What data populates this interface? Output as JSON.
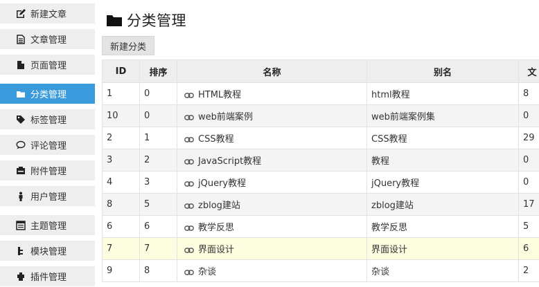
{
  "sidebar": {
    "items": [
      {
        "label": "新建文章",
        "icon": "edit-icon"
      },
      {
        "label": "文章管理",
        "icon": "document-icon"
      },
      {
        "label": "页面管理",
        "icon": "page-icon"
      },
      {
        "label": "分类管理",
        "icon": "folder-icon",
        "active": true
      },
      {
        "label": "标签管理",
        "icon": "tag-icon"
      },
      {
        "label": "评论管理",
        "icon": "comment-icon"
      },
      {
        "label": "附件管理",
        "icon": "attachment-icon"
      },
      {
        "label": "用户管理",
        "icon": "user-icon"
      },
      {
        "label": "主题管理",
        "icon": "theme-icon"
      },
      {
        "label": "模块管理",
        "icon": "module-icon"
      },
      {
        "label": "插件管理",
        "icon": "plugin-icon"
      }
    ]
  },
  "header": {
    "title": "分类管理",
    "icon": "folder-icon"
  },
  "toolbar": {
    "new_category_label": "新建分类"
  },
  "table": {
    "columns": [
      "ID",
      "排序",
      "名称",
      "别名",
      "文"
    ],
    "rows": [
      {
        "id": "1",
        "order": "0",
        "name": "HTML教程",
        "alias": "html教程",
        "count": "8"
      },
      {
        "id": "10",
        "order": "0",
        "name": "web前端案例",
        "alias": "web前端案例集",
        "count": "0"
      },
      {
        "id": "2",
        "order": "1",
        "name": "CSS教程",
        "alias": "CSS教程",
        "count": "29"
      },
      {
        "id": "3",
        "order": "2",
        "name": "JavaScript教程",
        "alias": "教程",
        "count": "0"
      },
      {
        "id": "4",
        "order": "3",
        "name": "jQuery教程",
        "alias": "jQuery教程",
        "count": "0"
      },
      {
        "id": "8",
        "order": "5",
        "name": "zblog建站",
        "alias": "zblog建站",
        "count": "17"
      },
      {
        "id": "6",
        "order": "6",
        "name": "教学反思",
        "alias": "教学反思",
        "count": "5"
      },
      {
        "id": "7",
        "order": "7",
        "name": "界面设计",
        "alias": "界面设计",
        "count": "6",
        "highlight": true
      },
      {
        "id": "9",
        "order": "8",
        "name": "杂谈",
        "alias": "杂谈",
        "count": "2"
      }
    ]
  },
  "colors": {
    "accent": "#3a9bdc",
    "row_highlight": "#fdfde0",
    "sidebar_bg": "#eeeeee"
  }
}
